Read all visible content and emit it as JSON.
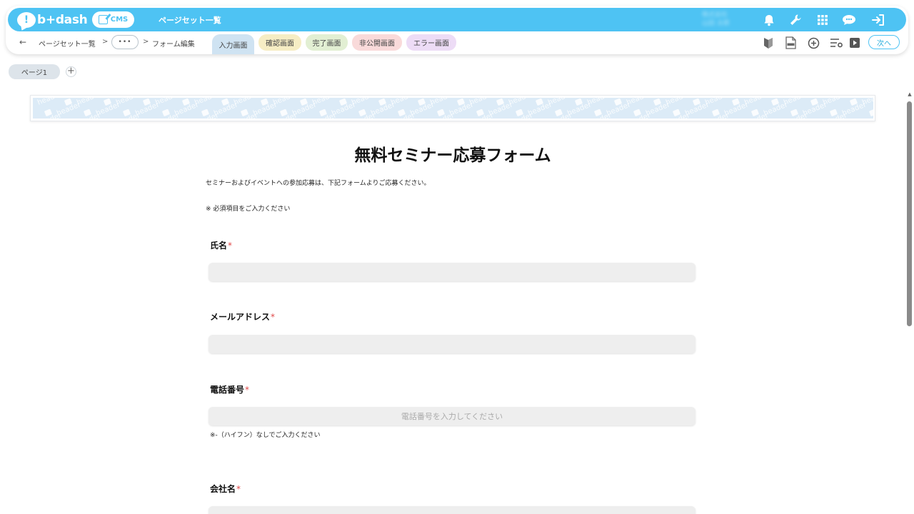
{
  "topbar": {
    "logo_text": "b+dash",
    "cms_label": "CMS",
    "page_title": "ページセット一覧",
    "user_name_line1": "株式会社",
    "user_name_line2": "山田 太郎"
  },
  "subbar": {
    "breadcrumbs": [
      "ページセット一覧",
      "フォーム編集"
    ],
    "separator": ">",
    "ellipsis": "•••",
    "stage_tabs": [
      {
        "label": "入力画面",
        "color": "#cfe3f2"
      },
      {
        "label": "確認画面",
        "color": "#f6edc4"
      },
      {
        "label": "完了画面",
        "color": "#e2efd3"
      },
      {
        "label": "非公開画面",
        "color": "#f9dada"
      },
      {
        "label": "エラー画面",
        "color": "#eddcf6"
      }
    ],
    "next_label": "次へ"
  },
  "page_tabs": {
    "current": "ページ1",
    "add": "+"
  },
  "header_placeholder": {
    "word": "header"
  },
  "form": {
    "title": "無料セミナー応募フォーム",
    "description": "セミナーおよびイベントへの参加応募は、下記フォームよりご応募ください。",
    "required_note": "※ 必須項目をご入力ください",
    "required_mark": "*",
    "fields": [
      {
        "label": "氏名",
        "placeholder": "",
        "hint": ""
      },
      {
        "label": "メールアドレス",
        "placeholder": "",
        "hint": ""
      },
      {
        "label": "電話番号",
        "placeholder": "電話番号を入力してください",
        "hint": "※-（ハイフン）なしでご入力ください"
      },
      {
        "label": "会社名",
        "placeholder": "",
        "hint": ""
      }
    ]
  },
  "colors": {
    "brand": "#4ec3f3",
    "required": "#e04848",
    "input_bg": "#eeeeee"
  },
  "icons": [
    "bell-icon",
    "wrench-icon",
    "grid-icon",
    "chat-icon",
    "logout-icon",
    "beginner-icon",
    "html-file-icon",
    "add-circle-icon",
    "list-settings-icon",
    "play-icon"
  ]
}
